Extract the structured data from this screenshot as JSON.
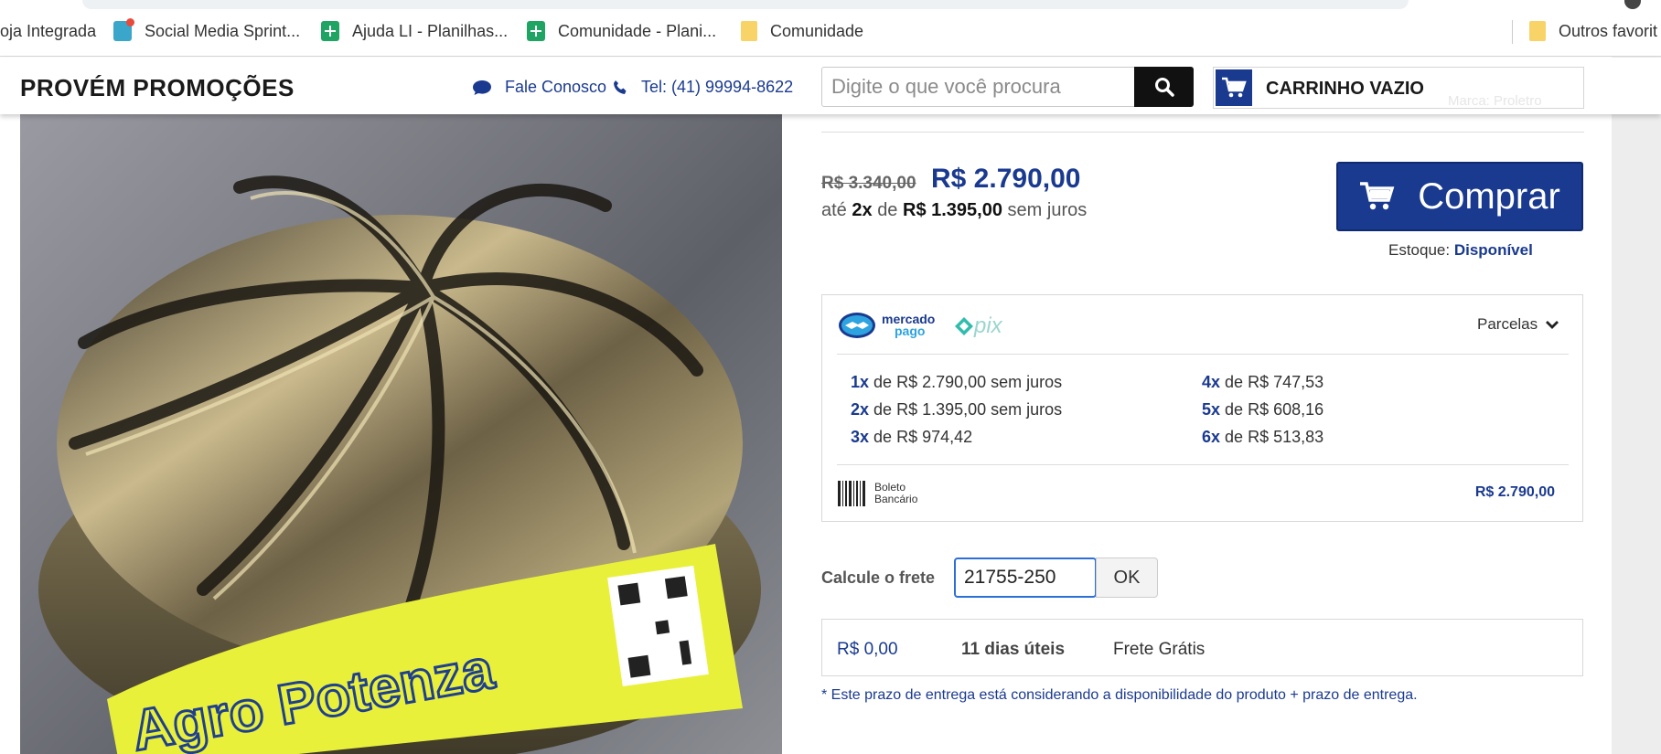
{
  "bookmarks": {
    "items": [
      {
        "label": "oja Integrada",
        "icon": "none"
      },
      {
        "label": "Social Media Sprint...",
        "icon": "social-media-icon"
      },
      {
        "label": "Ajuda LI - Planilhas...",
        "icon": "google-sheets-icon"
      },
      {
        "label": "Comunidade - Plani...",
        "icon": "google-sheets-icon"
      },
      {
        "label": "Comunidade",
        "icon": "folder-icon"
      },
      {
        "label": "Outros favorit",
        "icon": "folder-icon"
      }
    ]
  },
  "header": {
    "logo": "PROVÉM PROMOÇÕES",
    "contact_label": "Fale Conosco",
    "phone_label": "Tel: (41) 99994-8622",
    "search_placeholder": "Digite o que você procura",
    "cart_label": "CARRINHO VAZIO",
    "cart_behind_text": "Marca: Proletro"
  },
  "product": {
    "image_alt": "Agro Potenza",
    "old_price": "R$ 3.340,00",
    "price": "R$ 2.790,00",
    "installment_prefix": "até",
    "installment_count": "2x",
    "installment_mid": "de",
    "installment_value": "R$ 1.395,00",
    "installment_suffix": "sem juros",
    "buy_label": "Comprar",
    "stock_label": "Estoque:",
    "stock_value": "Disponível"
  },
  "payment": {
    "mercadopago_line1": "mercado",
    "mercadopago_line2": "pago",
    "pix_label": "pix",
    "parcelas_label": "Parcelas",
    "installments": [
      {
        "n": "1x",
        "text": "de R$ 2.790,00 sem juros"
      },
      {
        "n": "2x",
        "text": "de R$ 1.395,00 sem juros"
      },
      {
        "n": "3x",
        "text": "de R$ 974,42"
      },
      {
        "n": "4x",
        "text": "de R$ 747,53"
      },
      {
        "n": "5x",
        "text": "de R$ 608,16"
      },
      {
        "n": "6x",
        "text": "de R$ 513,83"
      }
    ],
    "boleto_line1": "Boleto",
    "boleto_line2": "Bancário",
    "boleto_price": "R$ 2.790,00"
  },
  "shipping": {
    "label": "Calcule o frete",
    "cep_value": "21755-250",
    "ok_label": "OK",
    "result_price": "R$ 0,00",
    "result_days": "11 dias úteis",
    "result_type": "Frete Grátis",
    "note": "* Este prazo de entrega está considerando a disponibilidade do produto + prazo de entrega."
  },
  "colors": {
    "brand": "#1a3a8f",
    "buy_button": "#1a3a8f"
  }
}
